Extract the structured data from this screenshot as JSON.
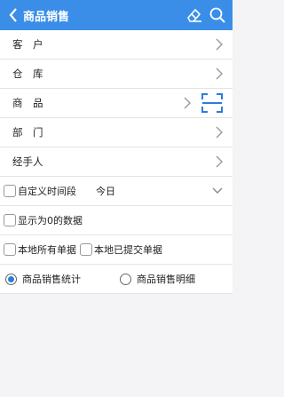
{
  "header": {
    "title": "商品销售",
    "icons": [
      "back-icon",
      "eraser-icon",
      "search-icon"
    ],
    "bg_color": "#3a8ee8"
  },
  "nav_rows": [
    {
      "label": "客　户"
    },
    {
      "label": "仓　库"
    },
    {
      "label": "商　品"
    },
    {
      "label": "部　门"
    },
    {
      "label": "经手人"
    }
  ],
  "options": {
    "custom_period": {
      "label": "自定义时间段",
      "checked": false
    },
    "period_value": "今日",
    "show_zero": {
      "label": "显示为0的数据",
      "checked": false
    },
    "local_all": {
      "label": "本地所有单据",
      "checked": false
    },
    "local_submitted": {
      "label": "本地已提交单据",
      "checked": false
    }
  },
  "report_type": {
    "stats": {
      "label": "商品销售统计",
      "selected": true
    },
    "detail": {
      "label": "商品销售明细",
      "selected": false
    }
  },
  "accent_color": "#2b7ce0"
}
